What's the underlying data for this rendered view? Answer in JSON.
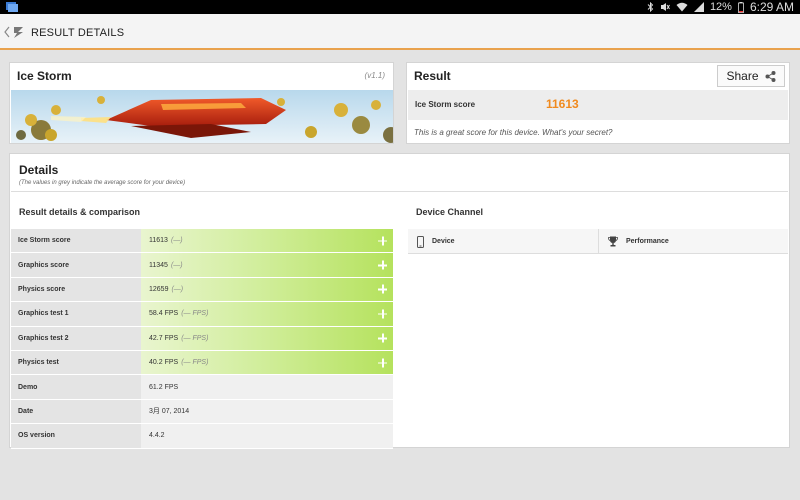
{
  "status_bar": {
    "battery": "12%",
    "time": "6:29 AM",
    "icons": [
      "bluetooth-icon",
      "mute-icon",
      "wifi-icon",
      "signal-icon",
      "battery-icon"
    ]
  },
  "action_bar": {
    "title": "RESULT DETAILS",
    "accent_color": "#e9a24d"
  },
  "test_card": {
    "name": "Ice Storm",
    "version": "(v1.1)"
  },
  "result_card": {
    "title": "Result",
    "share_label": "Share",
    "score_label": "Ice Storm score",
    "score_value": "11613",
    "score_color": "#f08a1e",
    "note": "This is a great score for this device. What's your secret?"
  },
  "details": {
    "title": "Details",
    "subtitle": "(The values in grey indicate the average score for your device)",
    "left_heading": "Result details & comparison",
    "right_heading": "Device Channel",
    "rows": [
      {
        "label": "Ice Storm score",
        "value": "11613",
        "avg": "(—)",
        "compare": true
      },
      {
        "label": "Graphics score",
        "value": "11345",
        "avg": "(—)",
        "compare": true
      },
      {
        "label": "Physics score",
        "value": "12659",
        "avg": "(—)",
        "compare": true
      },
      {
        "label": "Graphics test 1",
        "value": "58.4 FPS",
        "avg": "(— FPS)",
        "compare": true
      },
      {
        "label": "Graphics test 2",
        "value": "42.7 FPS",
        "avg": "(— FPS)",
        "compare": true
      },
      {
        "label": "Physics test",
        "value": "40.2 FPS",
        "avg": "(— FPS)",
        "compare": true
      },
      {
        "label": "Demo",
        "value": "61.2 FPS",
        "avg": "",
        "compare": false
      },
      {
        "label": "Date",
        "value": "3月 07, 2014",
        "avg": "",
        "compare": false
      },
      {
        "label": "OS version",
        "value": "4.4.2",
        "avg": "",
        "compare": false
      }
    ],
    "channel_columns": [
      {
        "label": "Device",
        "icon": "phone-icon"
      },
      {
        "label": "Performance",
        "icon": "trophy-icon"
      }
    ]
  }
}
